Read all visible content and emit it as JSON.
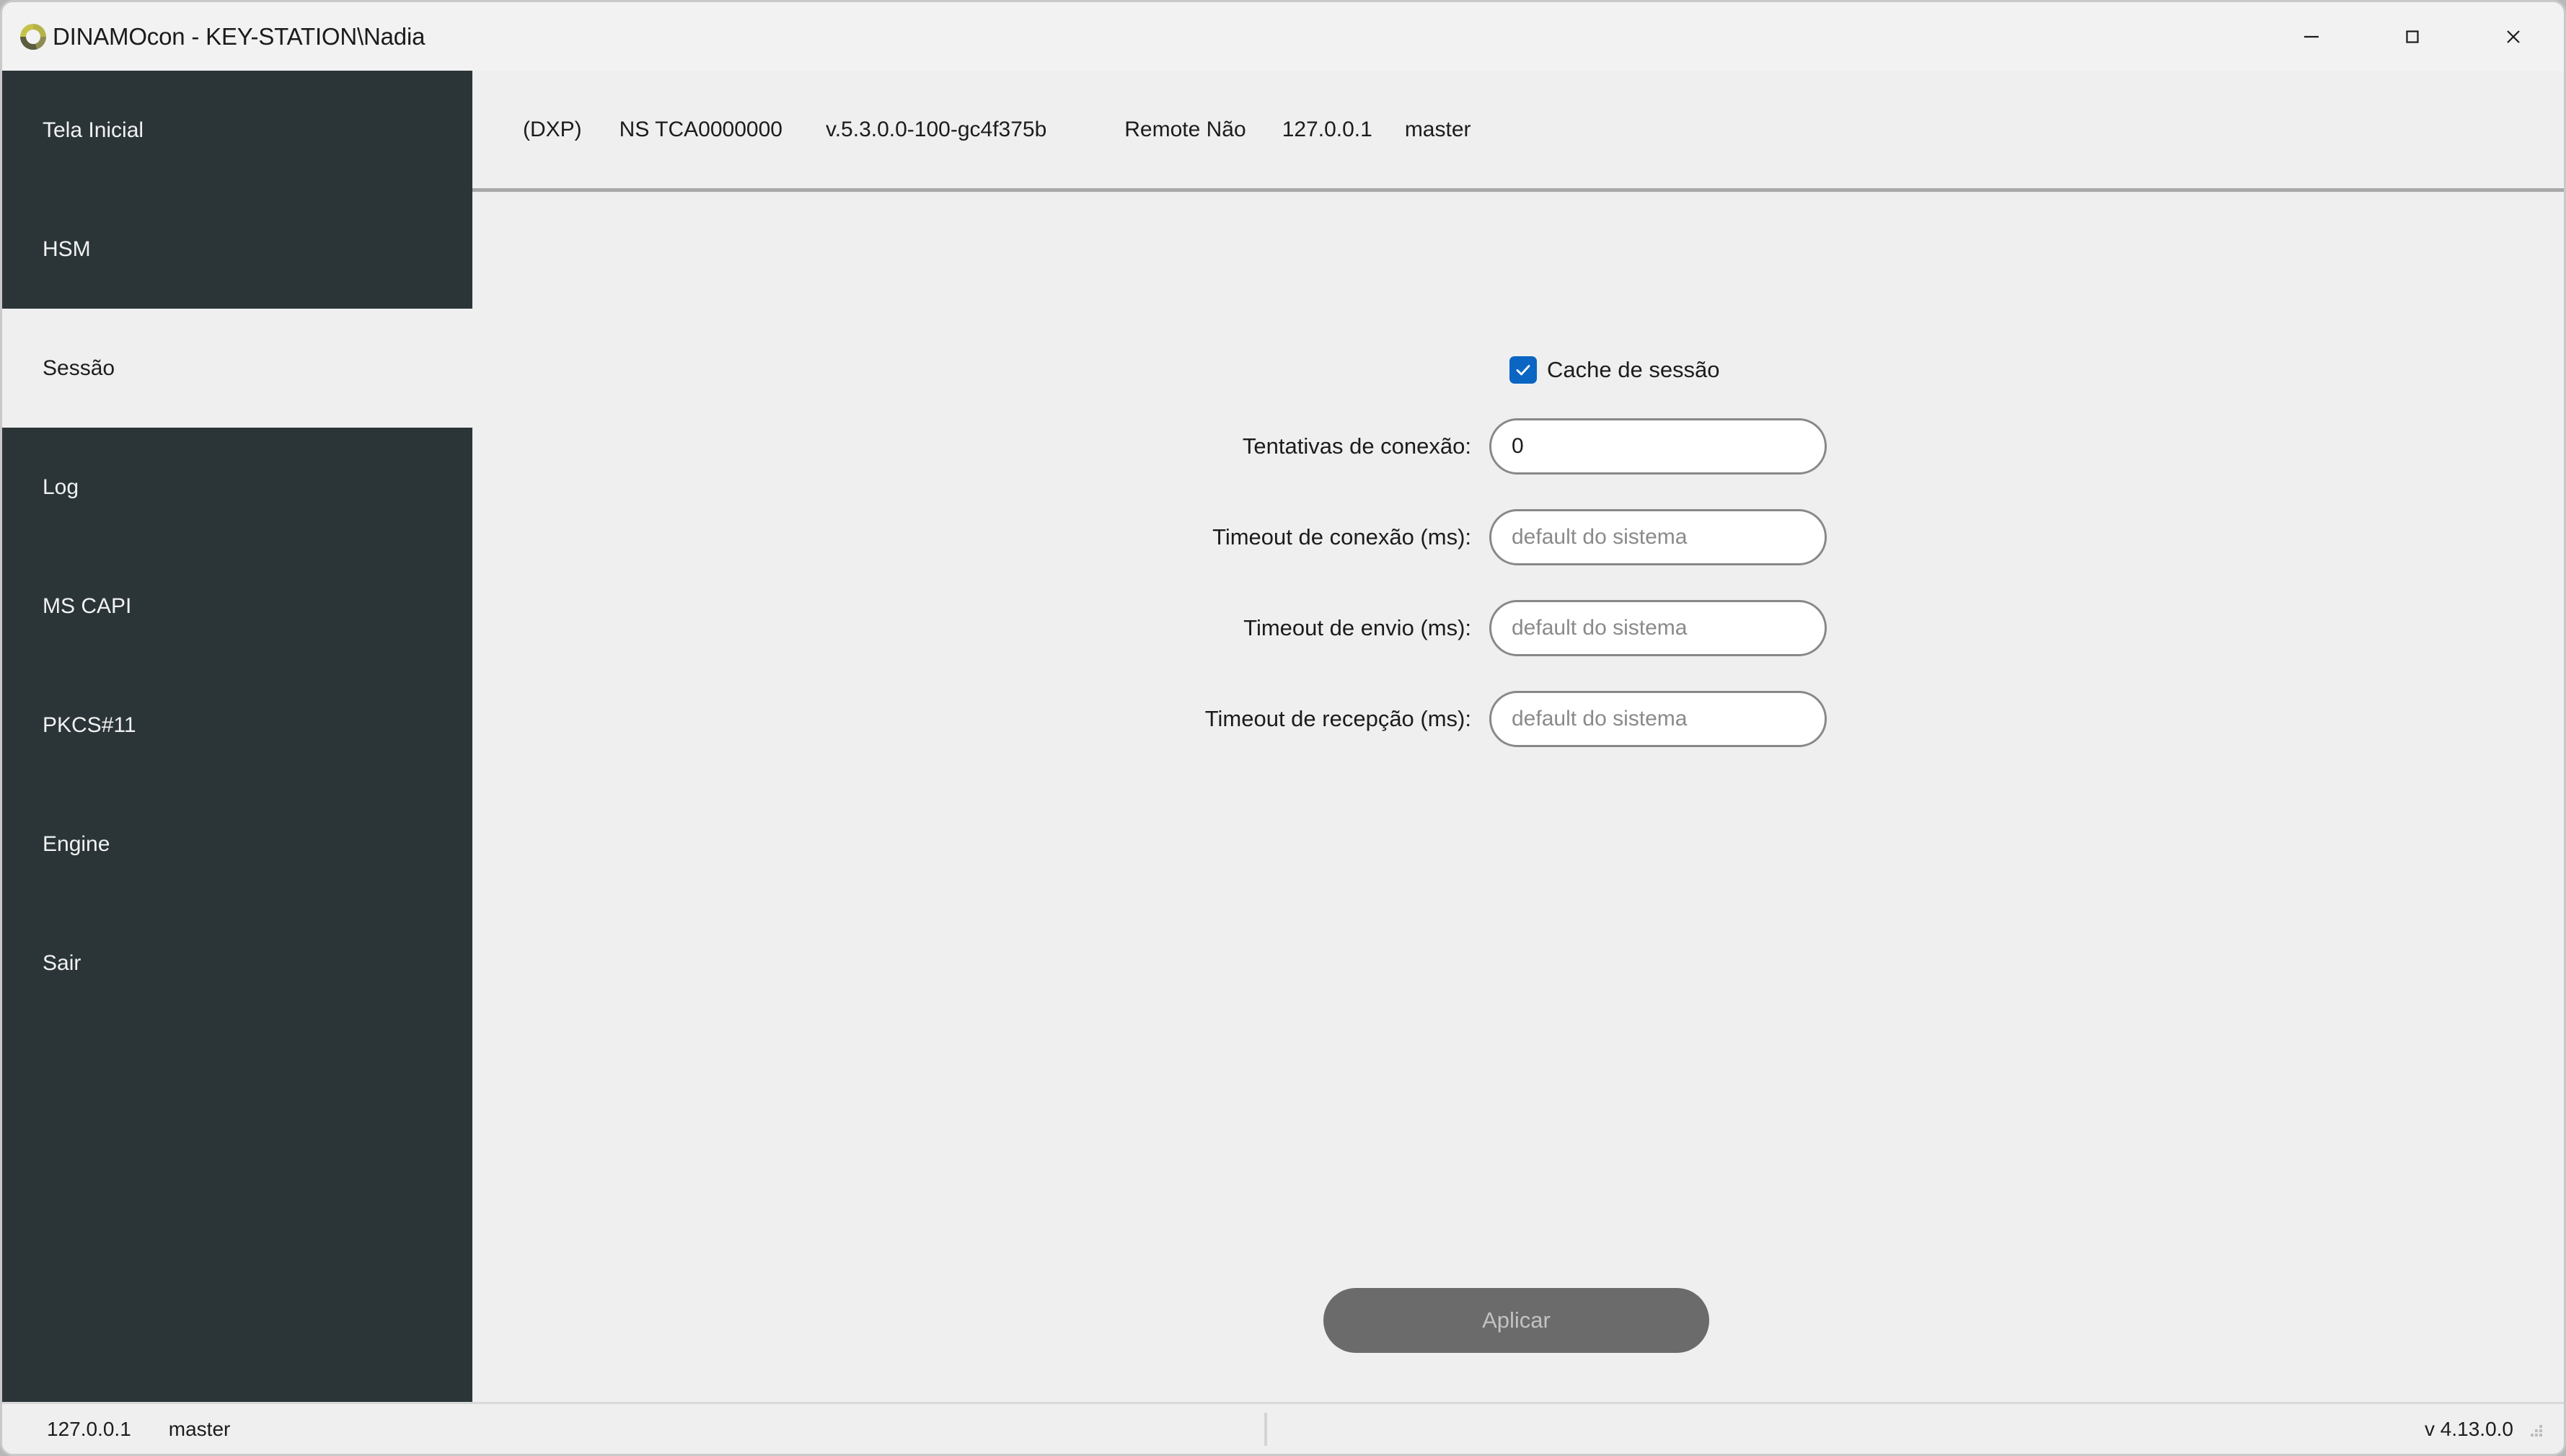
{
  "window": {
    "title": "DINAMOcon - KEY-STATION\\Nadia",
    "logo_icon": "dinamo-ring-logo",
    "controls": {
      "minimize": "minimize-icon",
      "maximize": "maximize-icon",
      "close": "close-icon"
    }
  },
  "infobar": {
    "mode": "(DXP)",
    "serial_label": "NS TCA0000000",
    "version": "v.5.3.0.0-100-gc4f375b",
    "remote": "Remote Não",
    "address": "127.0.0.1",
    "user": "master"
  },
  "sidebar": {
    "items": [
      {
        "label": "Tela Inicial",
        "selected": false
      },
      {
        "label": "HSM",
        "selected": false
      },
      {
        "label": "Sessão",
        "selected": true
      },
      {
        "label": "Log",
        "selected": false
      },
      {
        "label": "MS CAPI",
        "selected": false
      },
      {
        "label": "PKCS#11",
        "selected": false
      },
      {
        "label": "Engine",
        "selected": false
      },
      {
        "label": "Sair",
        "selected": false
      }
    ]
  },
  "form": {
    "cache_checkbox": {
      "label": "Cache de sessão",
      "checked": true,
      "icon": "check-icon",
      "color": "#0a66c2"
    },
    "fields": [
      {
        "label": "Tentativas de conexão:",
        "value": "0",
        "placeholder": ""
      },
      {
        "label": "Timeout de conexão (ms):",
        "value": "",
        "placeholder": "default do sistema"
      },
      {
        "label": "Timeout de envio (ms):",
        "value": "",
        "placeholder": "default do sistema"
      },
      {
        "label": "Timeout de recepção (ms):",
        "value": "",
        "placeholder": "default do sistema"
      }
    ],
    "apply_label": "Aplicar"
  },
  "statusbar": {
    "address": "127.0.0.1",
    "user": "master",
    "version": "v 4.13.0.0",
    "grip_icon": "resize-grip-icon"
  },
  "colors": {
    "sidebar_bg": "#2b3538",
    "content_bg": "#efefef",
    "accent": "#0a66c2",
    "disabled_button": "#6b6b6b",
    "logo_light": "#c5c24a",
    "logo_dark": "#5d5c3f"
  }
}
